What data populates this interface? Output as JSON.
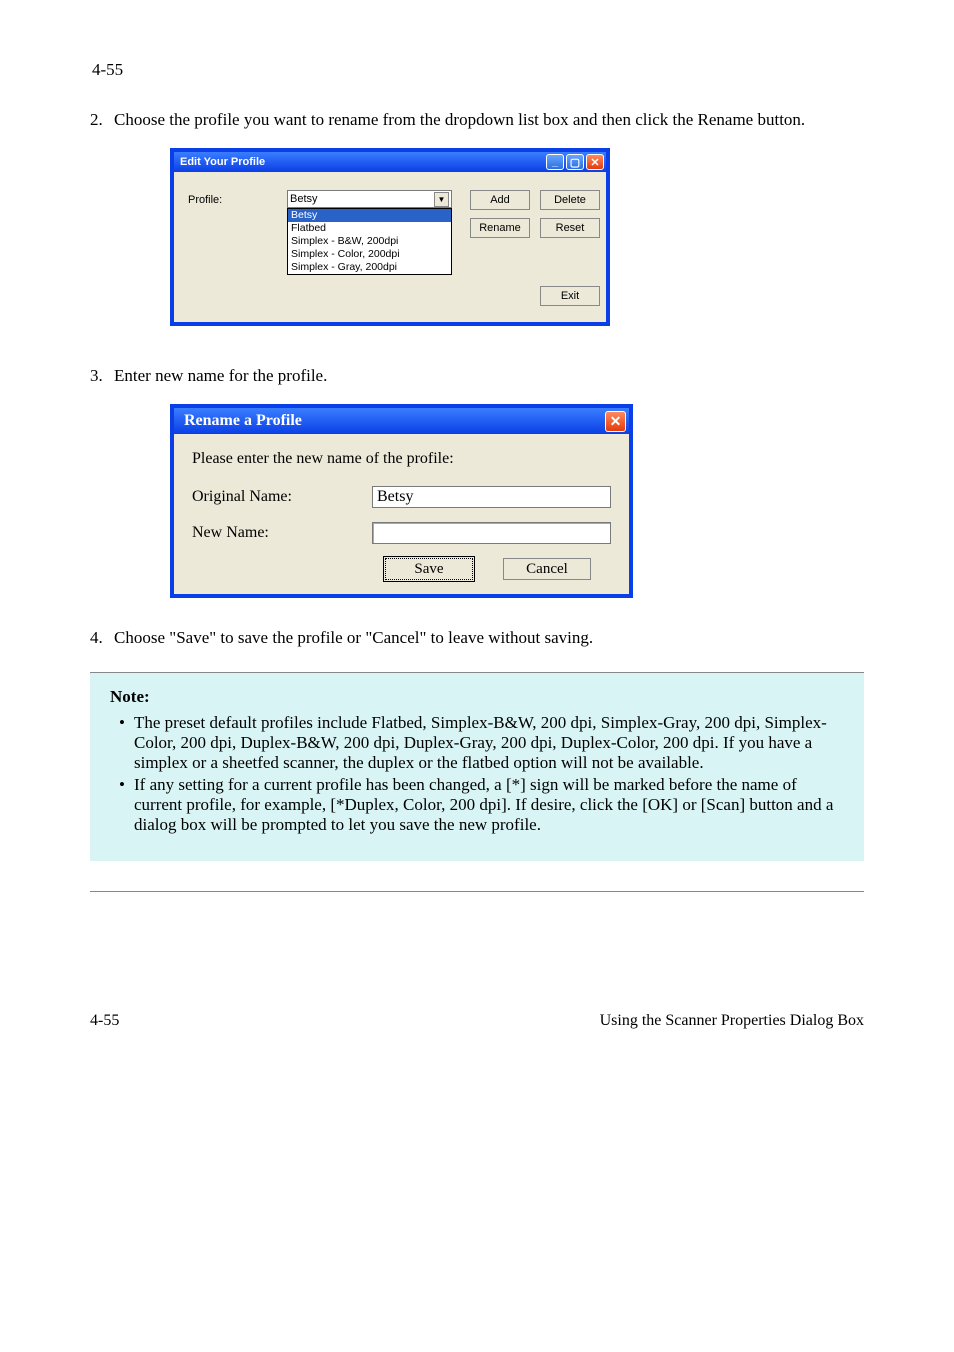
{
  "page_num_top": "4-55",
  "instr": [
    {
      "n": "2.",
      "t": "Choose the profile you want to rename from the dropdown list box and then click the Rename button."
    },
    {
      "n": "3.",
      "t": "Enter new name for the profile."
    },
    {
      "n": "4.",
      "t": "Choose \"Save\" to save the profile or \"Cancel\" to leave without saving."
    }
  ],
  "dlg1": {
    "title": "Edit Your Profile",
    "label": "Profile:",
    "selected": "Betsy",
    "options": [
      "Betsy",
      "Flatbed",
      "Simplex - B&W, 200dpi",
      "Simplex - Color, 200dpi",
      "Simplex - Gray, 200dpi"
    ],
    "buttons": {
      "add": "Add",
      "delete": "Delete",
      "rename": "Rename",
      "reset": "Reset",
      "exit": "Exit"
    }
  },
  "dlg2": {
    "title": "Rename a Profile",
    "prompt": "Please enter the new name of the profile:",
    "orig_label": "Original Name:",
    "orig_value": "Betsy",
    "new_label": "New Name:",
    "new_value": "",
    "save": "Save",
    "cancel": "Cancel"
  },
  "note": {
    "head": "Note:",
    "b1": "The preset default profiles include Flatbed, Simplex-B&W, 200 dpi, Simplex-Gray, 200 dpi, Simplex-Color, 200 dpi, Duplex-B&W, 200 dpi, Duplex-Gray, 200 dpi, Duplex-Color, 200 dpi. If you have a simplex or a sheetfed scanner, the duplex or the flatbed option will not be available.",
    "b2": "If any setting for a current profile has been changed, a [*] sign will be marked before the name of current profile, for example, [*Duplex, Color, 200 dpi]. If desire, click the [OK] or [Scan] button and a dialog box will be prompted to let you save the new profile."
  },
  "footer_section": "Using the Scanner Properties Dialog Box"
}
